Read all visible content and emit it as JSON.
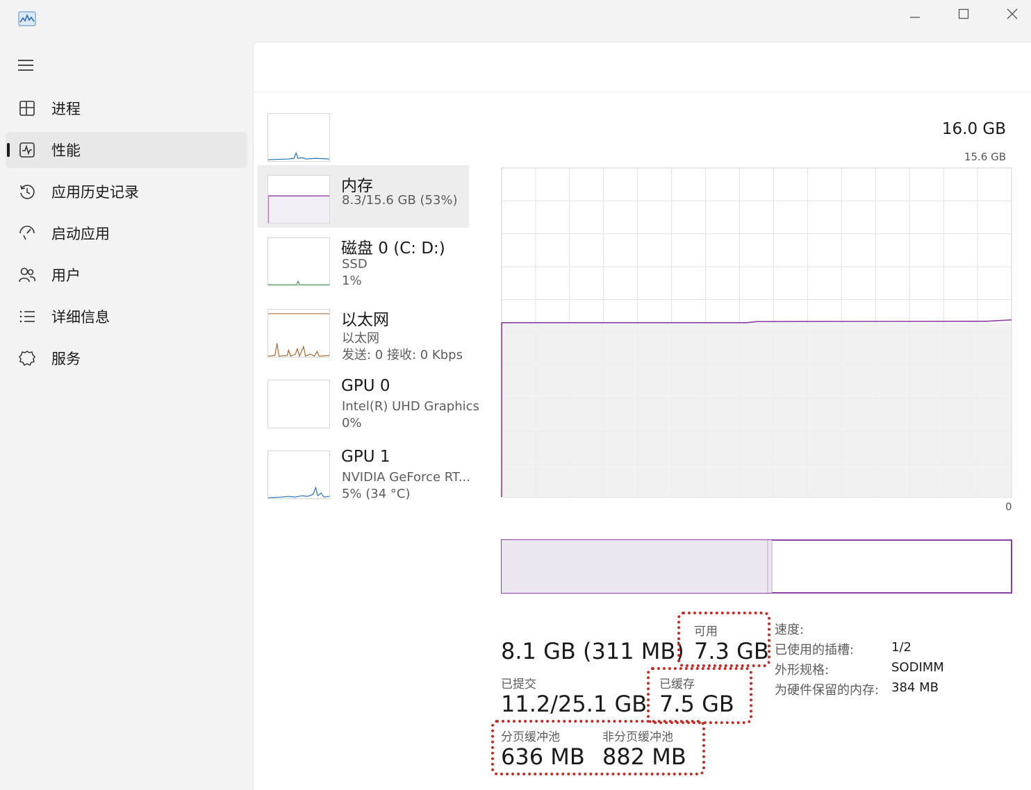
{
  "titlebar": {
    "minimize_icon": "minimize-icon",
    "maximize_icon": "maximize-icon",
    "close_icon": "close-icon"
  },
  "sidebar": {
    "items": [
      {
        "label": "进程",
        "icon": "processes-icon"
      },
      {
        "label": "性能",
        "icon": "performance-icon"
      },
      {
        "label": "应用历史记录",
        "icon": "history-icon"
      },
      {
        "label": "启动应用",
        "icon": "startup-icon"
      },
      {
        "label": "用户",
        "icon": "users-icon"
      },
      {
        "label": "详细信息",
        "icon": "details-icon"
      },
      {
        "label": "服务",
        "icon": "services-icon"
      }
    ],
    "active_index": 1
  },
  "devices": [
    {
      "title": "内存",
      "sub1": "8.3/15.6 GB (53%)",
      "sub2": ""
    },
    {
      "title": "磁盘 0 (C: D:)",
      "sub1": "SSD",
      "sub2": "1%"
    },
    {
      "title": "以太网",
      "sub1": "以太网",
      "sub2": "发送: 0 接收: 0 Kbps"
    },
    {
      "title": "GPU 0",
      "sub1": "Intel(R) UHD Graphics",
      "sub2": "0%"
    },
    {
      "title": "GPU 1",
      "sub1": "NVIDIA GeForce RT...",
      "sub2": "5% (34 °C)"
    }
  ],
  "memory": {
    "total": "16.0 GB",
    "max_label": "15.6 GB",
    "min_label": "0",
    "usage_fraction": 0.53,
    "in_use_value": "8.1 GB (311 MB)",
    "available_label": "可用",
    "available_value": "7.3 GB",
    "committed_label": "已提交",
    "committed_value": "11.2/25.1 GB",
    "cached_label": "已缓存",
    "cached_value": "7.5 GB",
    "paged_label": "分页缓冲池",
    "paged_value": "636 MB",
    "nonpaged_label": "非分页缓冲池",
    "nonpaged_value": "882 MB",
    "speed_label": "速度:",
    "slots_label": "已使用的插槽:",
    "slots_value": "1/2",
    "form_label": "外形规格:",
    "form_value": "SODIMM",
    "reserved_label": "为硬件保留的内存:",
    "reserved_value": "384 MB"
  },
  "colors": {
    "memory_line": "#8b3ea3",
    "memory_fill": "#efefef",
    "composition_fill": "#ece6f0",
    "highlight": "#c62a23",
    "cpu_line": "#1f6fb8",
    "ethernet_line": "#a8622a",
    "disk_line": "#3c9a4c"
  }
}
